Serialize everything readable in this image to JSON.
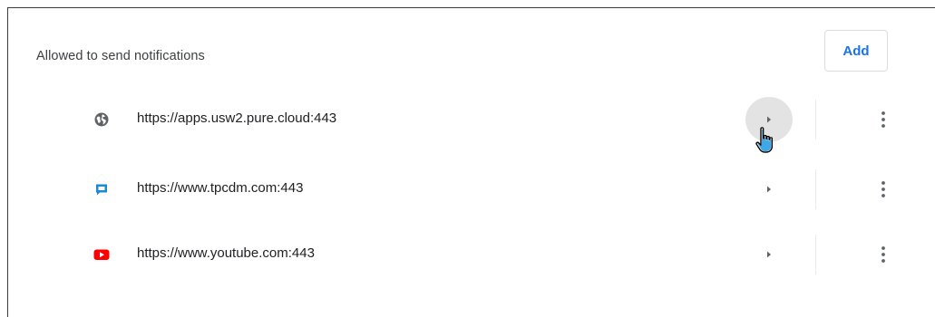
{
  "section": {
    "title": "Allowed to send notifications",
    "add_label": "Add"
  },
  "sites": [
    {
      "url": "https://apps.usw2.pure.cloud:443",
      "icon": "globe-icon"
    },
    {
      "url": "https://www.tpcdm.com:443",
      "icon": "tpcdm-favicon-icon"
    },
    {
      "url": "https://www.youtube.com:443",
      "icon": "youtube-favicon-icon"
    }
  ],
  "colors": {
    "accent": "#1a73e8",
    "youtube_red": "#ff0000",
    "tpcdm_blue": "#1e88d6",
    "hover_circle": "#e3e3e3"
  }
}
